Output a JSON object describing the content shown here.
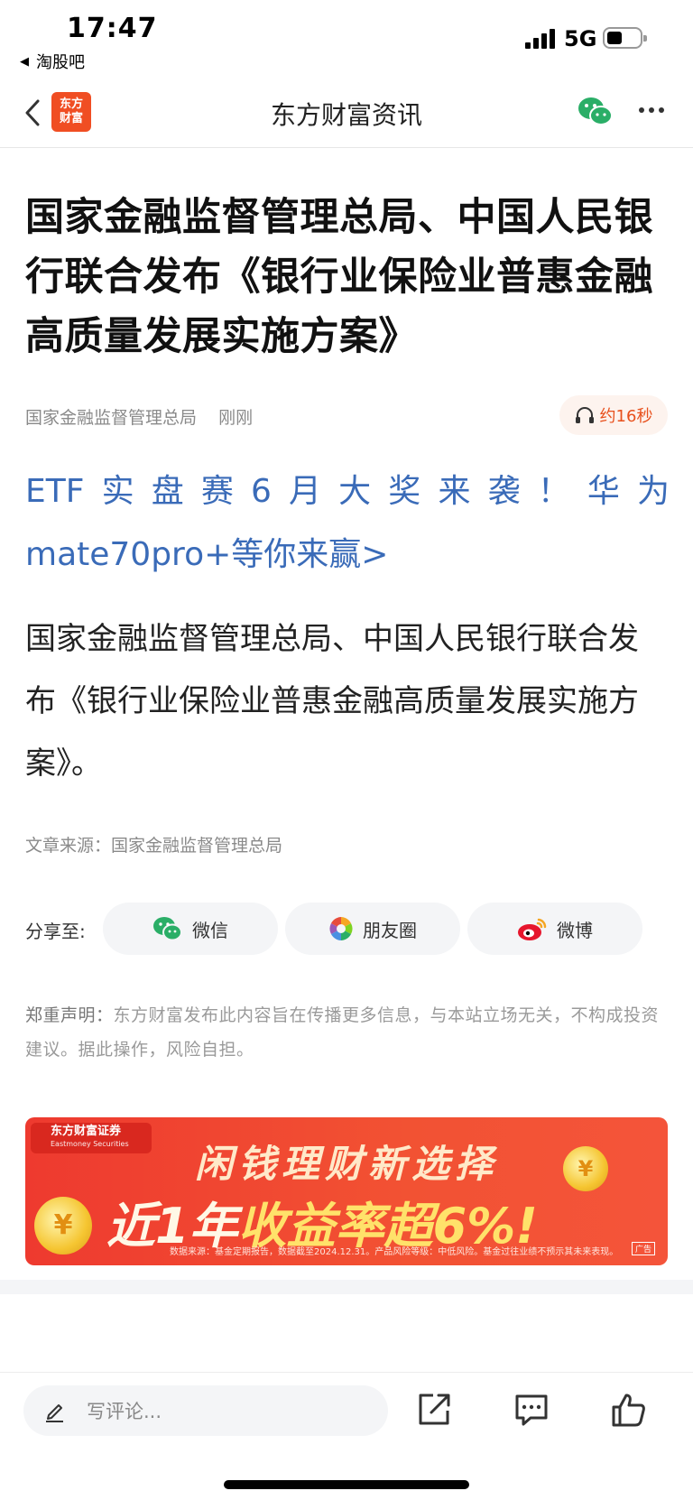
{
  "status_bar": {
    "time": "17:47",
    "back_app": "淘股吧",
    "network": "5G"
  },
  "nav": {
    "logo_line1": "东方",
    "logo_line2": "财富",
    "title": "东方财富资讯"
  },
  "article": {
    "headline": "国家金融监督管理总局、中国人民银行联合发布《银行业保险业普惠金融高质量发展实施方案》",
    "author": "国家金融监督管理总局",
    "time_ago": "刚刚",
    "listen_label": "约16秒",
    "promo_link": "ETF实盘赛6月大奖来袭！华为mate70pro+等你来赢>",
    "body": "国家金融监督管理总局、中国人民银行联合发布《银行业保险业普惠金融高质量发展实施方案》。",
    "source": "文章来源：国家金融监督管理总局"
  },
  "share": {
    "label": "分享至:",
    "wechat": "微信",
    "moments": "朋友圈",
    "weibo": "微博"
  },
  "disclaimer": {
    "title": "郑重声明：",
    "text": "东方财富发布此内容旨在传播更多信息，与本站立场无关，不构成投资建议。据此操作，风险自担。"
  },
  "ad": {
    "brand": "东方财富证券",
    "brand_en": "Eastmoney Securities",
    "line1": "闲钱理财新选择",
    "line2_prefix": "近1年",
    "line2_highlight": "收益率超6%!",
    "note": "数据来源：基金定期报告，数据截至2024.12.31。产品风险等级：中低风险。基金过往业绩不预示其未来表现。",
    "tag": "广告"
  },
  "bottom_bar": {
    "comment_placeholder": "写评论..."
  },
  "colors": {
    "brand_orange": "#f04e23",
    "link_blue": "#3a6bb8",
    "wechat_green": "#2aae67"
  }
}
